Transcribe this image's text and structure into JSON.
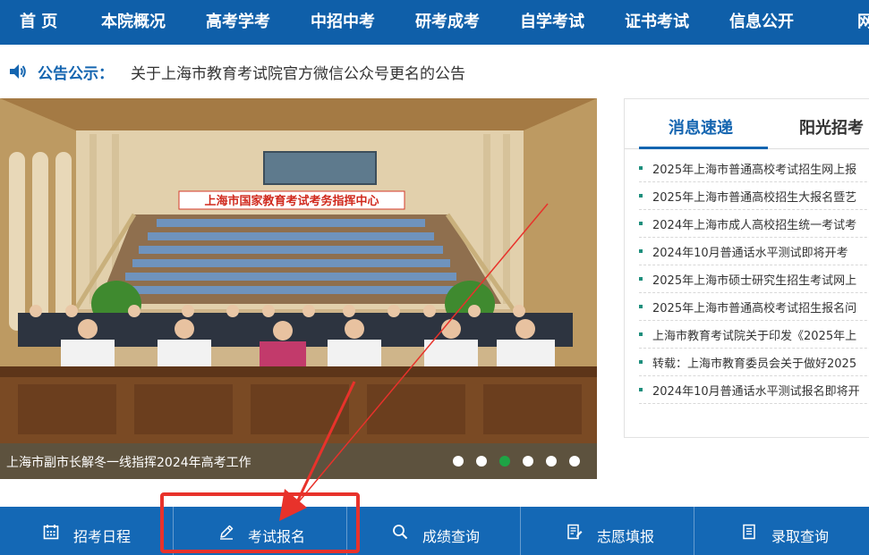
{
  "nav": {
    "items": [
      {
        "label": "首 页"
      },
      {
        "label": "本院概况"
      },
      {
        "label": "高考学考"
      },
      {
        "label": "中招中考"
      },
      {
        "label": "研考成考"
      },
      {
        "label": "自学考试"
      },
      {
        "label": "证书考试"
      },
      {
        "label": "信息公开"
      },
      {
        "label": "网"
      }
    ]
  },
  "notice": {
    "icon": "speaker-icon",
    "label": "公告公示：",
    "text": "关于上海市教育考试院官方微信公众号更名的公告"
  },
  "banner": {
    "hall_sign": "上海市国家教育考试考务指挥中心",
    "caption": "上海市副市长解冬一线指挥2024年高考工作",
    "slide_count": 6,
    "active_slide": 3
  },
  "news": {
    "tabs": [
      {
        "label": "消息速递",
        "active": true
      },
      {
        "label": "阳光招考",
        "active": false
      }
    ],
    "items": [
      {
        "title": "2025年上海市普通高校考试招生网上报"
      },
      {
        "title": "2025年上海市普通高校招生大报名暨艺"
      },
      {
        "title": "2024年上海市成人高校招生统一考试考"
      },
      {
        "title": "2024年10月普通话水平测试即将开考"
      },
      {
        "title": "2025年上海市硕士研究生招生考试网上"
      },
      {
        "title": "2025年上海市普通高校考试招生报名问"
      },
      {
        "title": "上海市教育考试院关于印发《2025年上"
      },
      {
        "title": "转载：上海市教育委员会关于做好2025"
      },
      {
        "title": "2024年10月普通话水平测试报名即将开"
      }
    ]
  },
  "quick_links": [
    {
      "label": "招考日程",
      "icon": "calendar-icon"
    },
    {
      "label": "考试报名",
      "icon": "pen-icon"
    },
    {
      "label": "成绩查询",
      "icon": "search-icon"
    },
    {
      "label": "志愿填报",
      "icon": "form-edit-icon"
    },
    {
      "label": "录取查询",
      "icon": "document-icon"
    }
  ],
  "colors": {
    "nav_bg": "#0f5fa9",
    "quickbar_bg": "#1468b5",
    "accent_blue": "#1465b0",
    "annotation_red": "#e8322b",
    "active_dot": "#1ea445"
  }
}
